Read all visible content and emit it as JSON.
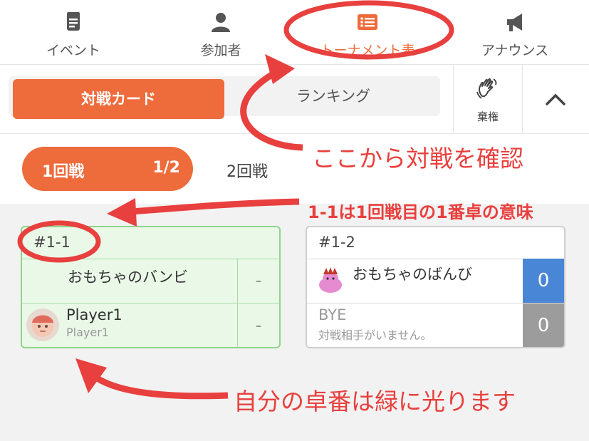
{
  "nav": {
    "items": [
      {
        "label": "イベント",
        "icon": "document-icon"
      },
      {
        "label": "参加者",
        "icon": "person-icon"
      },
      {
        "label": "トーナメント表",
        "icon": "bracket-list-icon",
        "active": true
      },
      {
        "label": "アナウンス",
        "icon": "megaphone-icon"
      }
    ]
  },
  "toolbar": {
    "match_card_label": "対戦カード",
    "ranking_label": "ランキング",
    "forfeit_label": "棄権",
    "collapse_icon": "chevron-up-icon"
  },
  "rounds": {
    "active_label": "1回戦",
    "active_page": "1/2",
    "second_label": "2回戦"
  },
  "matches": [
    {
      "id": "#1-1",
      "mine": true,
      "players": [
        {
          "name": "おもちゃのバンビ",
          "sub": "",
          "score": "-"
        },
        {
          "name": "Player1",
          "sub": "Player1",
          "score": "-"
        }
      ]
    },
    {
      "id": "#1-2",
      "mine": false,
      "players": [
        {
          "name": "おもちゃのばんび",
          "sub": "",
          "score": "0"
        },
        {
          "name": "BYE",
          "sub": "対戦相手がいません。",
          "score": "0"
        }
      ]
    }
  ],
  "annotations": {
    "confirm": "ここから対戦を確認",
    "meaning": "1-1は1回戦目の1番卓の意味",
    "green": "自分の卓番は緑に光ります"
  },
  "colors": {
    "accent": "#ee6b3b",
    "annotation": "#e8403e",
    "mine_bg": "#eaf8e8",
    "mine_border": "#8fd48a",
    "score_blue": "#4a86d6",
    "score_grey": "#9c9c9c"
  }
}
